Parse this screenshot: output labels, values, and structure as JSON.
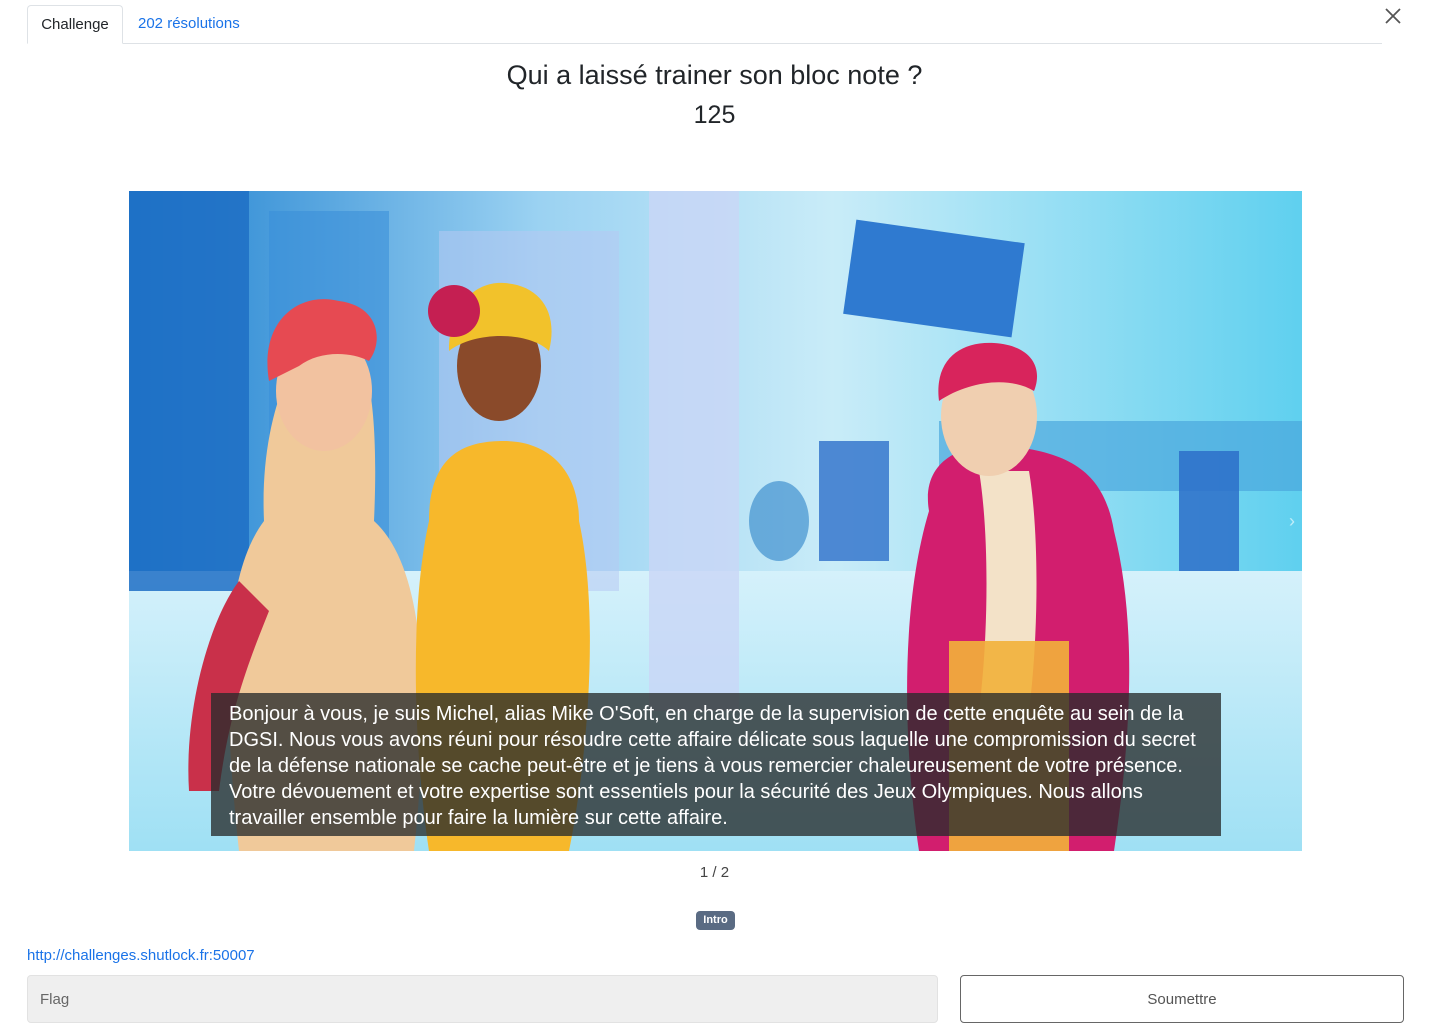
{
  "tabs": [
    {
      "label": "Challenge"
    },
    {
      "label": "202 résolutions"
    }
  ],
  "challenge": {
    "title": "Qui a laissé trainer son bloc note ?",
    "points": "125"
  },
  "carousel": {
    "caption": "Bonjour à vous, je suis Michel, alias Mike O'Soft, en charge de la supervision de cette enquête au sein de la DGSI. Nous vous avons réuni pour résoudre cette affaire délicate sous laquelle une compromission du secret de la défense nationale se cache peut-être et je tiens à vous remercier chaleureusement de votre présence. Votre dévouement et votre expertise sont essentiels pour la sécurité des Jeux Olympiques. Nous allons travailler ensemble pour faire la lumière sur cette affaire.",
    "counter": "1 / 2"
  },
  "tag": "Intro",
  "connection_url": "http://challenges.shutlock.fr:50007",
  "form": {
    "flag_placeholder": "Flag",
    "submit_label": "Soumettre"
  },
  "colors": {
    "link": "#1a73e8",
    "tag_bg": "#5a6b83",
    "scene_bg": "#7fd6ee"
  }
}
